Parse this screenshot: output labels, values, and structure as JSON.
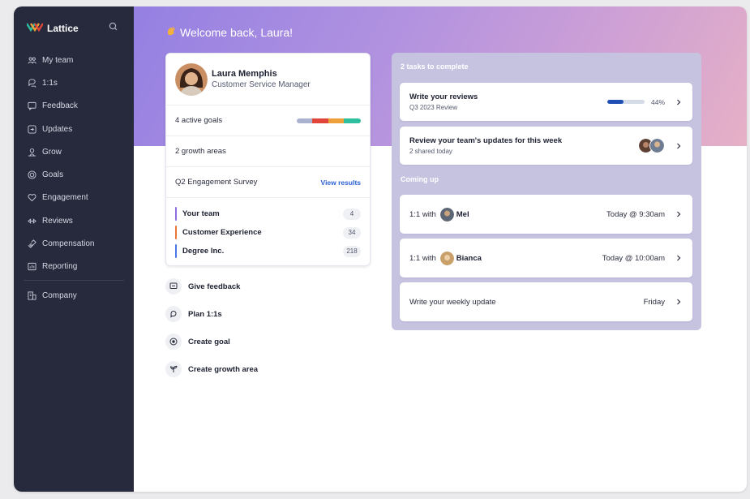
{
  "colors": {
    "sidebar_bg": "#272a3d",
    "accent_blue": "#2c62d6",
    "progress_fill": "#1f4fb4",
    "panel_bg": "#c6c3e1",
    "goal_segments": [
      "#a9b3cf",
      "#e0463a",
      "#eca13a",
      "#2fbf9f"
    ],
    "team_bars": [
      "#8f6fe0",
      "#e8763a",
      "#4a78e6"
    ]
  },
  "sidebar": {
    "brand": "Lattice",
    "brand_icon": "lattice-logo",
    "search_icon": "search-icon",
    "items": [
      {
        "label": "My team",
        "icon": "people-icon"
      },
      {
        "label": "1:1s",
        "icon": "chat-bubbles-icon"
      },
      {
        "label": "Feedback",
        "icon": "message-square-icon"
      },
      {
        "label": "Updates",
        "icon": "update-arrow-icon"
      },
      {
        "label": "Grow",
        "icon": "grow-icon"
      },
      {
        "label": "Goals",
        "icon": "target-icon"
      },
      {
        "label": "Engagement",
        "icon": "heart-icon"
      },
      {
        "label": "Reviews",
        "icon": "arrows-icon"
      },
      {
        "label": "Compensation",
        "icon": "compensation-icon"
      },
      {
        "label": "Reporting",
        "icon": "report-icon"
      }
    ],
    "company": {
      "label": "Company",
      "icon": "building-icon"
    }
  },
  "header": {
    "welcome": "Welcome back, Laura!",
    "wave_icon": "wave-hand-icon"
  },
  "profile": {
    "name": "Laura Memphis",
    "role": "Customer Service Manager",
    "goals_label": "4 active goals",
    "growth_label": "2 growth areas",
    "survey_label": "Q2 Engagement Survey",
    "survey_link": "View results",
    "teams": [
      {
        "name": "Your team",
        "count": "4"
      },
      {
        "name": "Customer Experience",
        "count": "34"
      },
      {
        "name": "Degree Inc.",
        "count": "218"
      }
    ]
  },
  "quick_actions": [
    {
      "label": "Give feedback",
      "icon": "feedback-icon"
    },
    {
      "label": "Plan 1:1s",
      "icon": "chat-bubble-icon"
    },
    {
      "label": "Create goal",
      "icon": "target-icon"
    },
    {
      "label": "Create growth area",
      "icon": "sprout-icon"
    }
  ],
  "tasks": {
    "heading": "2 tasks to complete",
    "items": [
      {
        "title": "Write your reviews",
        "subtitle": "Q3 2023 Review",
        "progress": 0.44,
        "progress_label": "44%"
      },
      {
        "title": "Review your team's updates for this week",
        "subtitle": "2 shared today"
      }
    ]
  },
  "coming_up": {
    "heading": "Coming up",
    "items": [
      {
        "prefix": "1:1 with",
        "person": "Mel",
        "time": "Today @ 9:30am"
      },
      {
        "prefix": "1:1 with",
        "person": "Bianca",
        "time": "Today @ 10:00am"
      },
      {
        "label": "Write your weekly update",
        "time": "Friday"
      }
    ]
  }
}
